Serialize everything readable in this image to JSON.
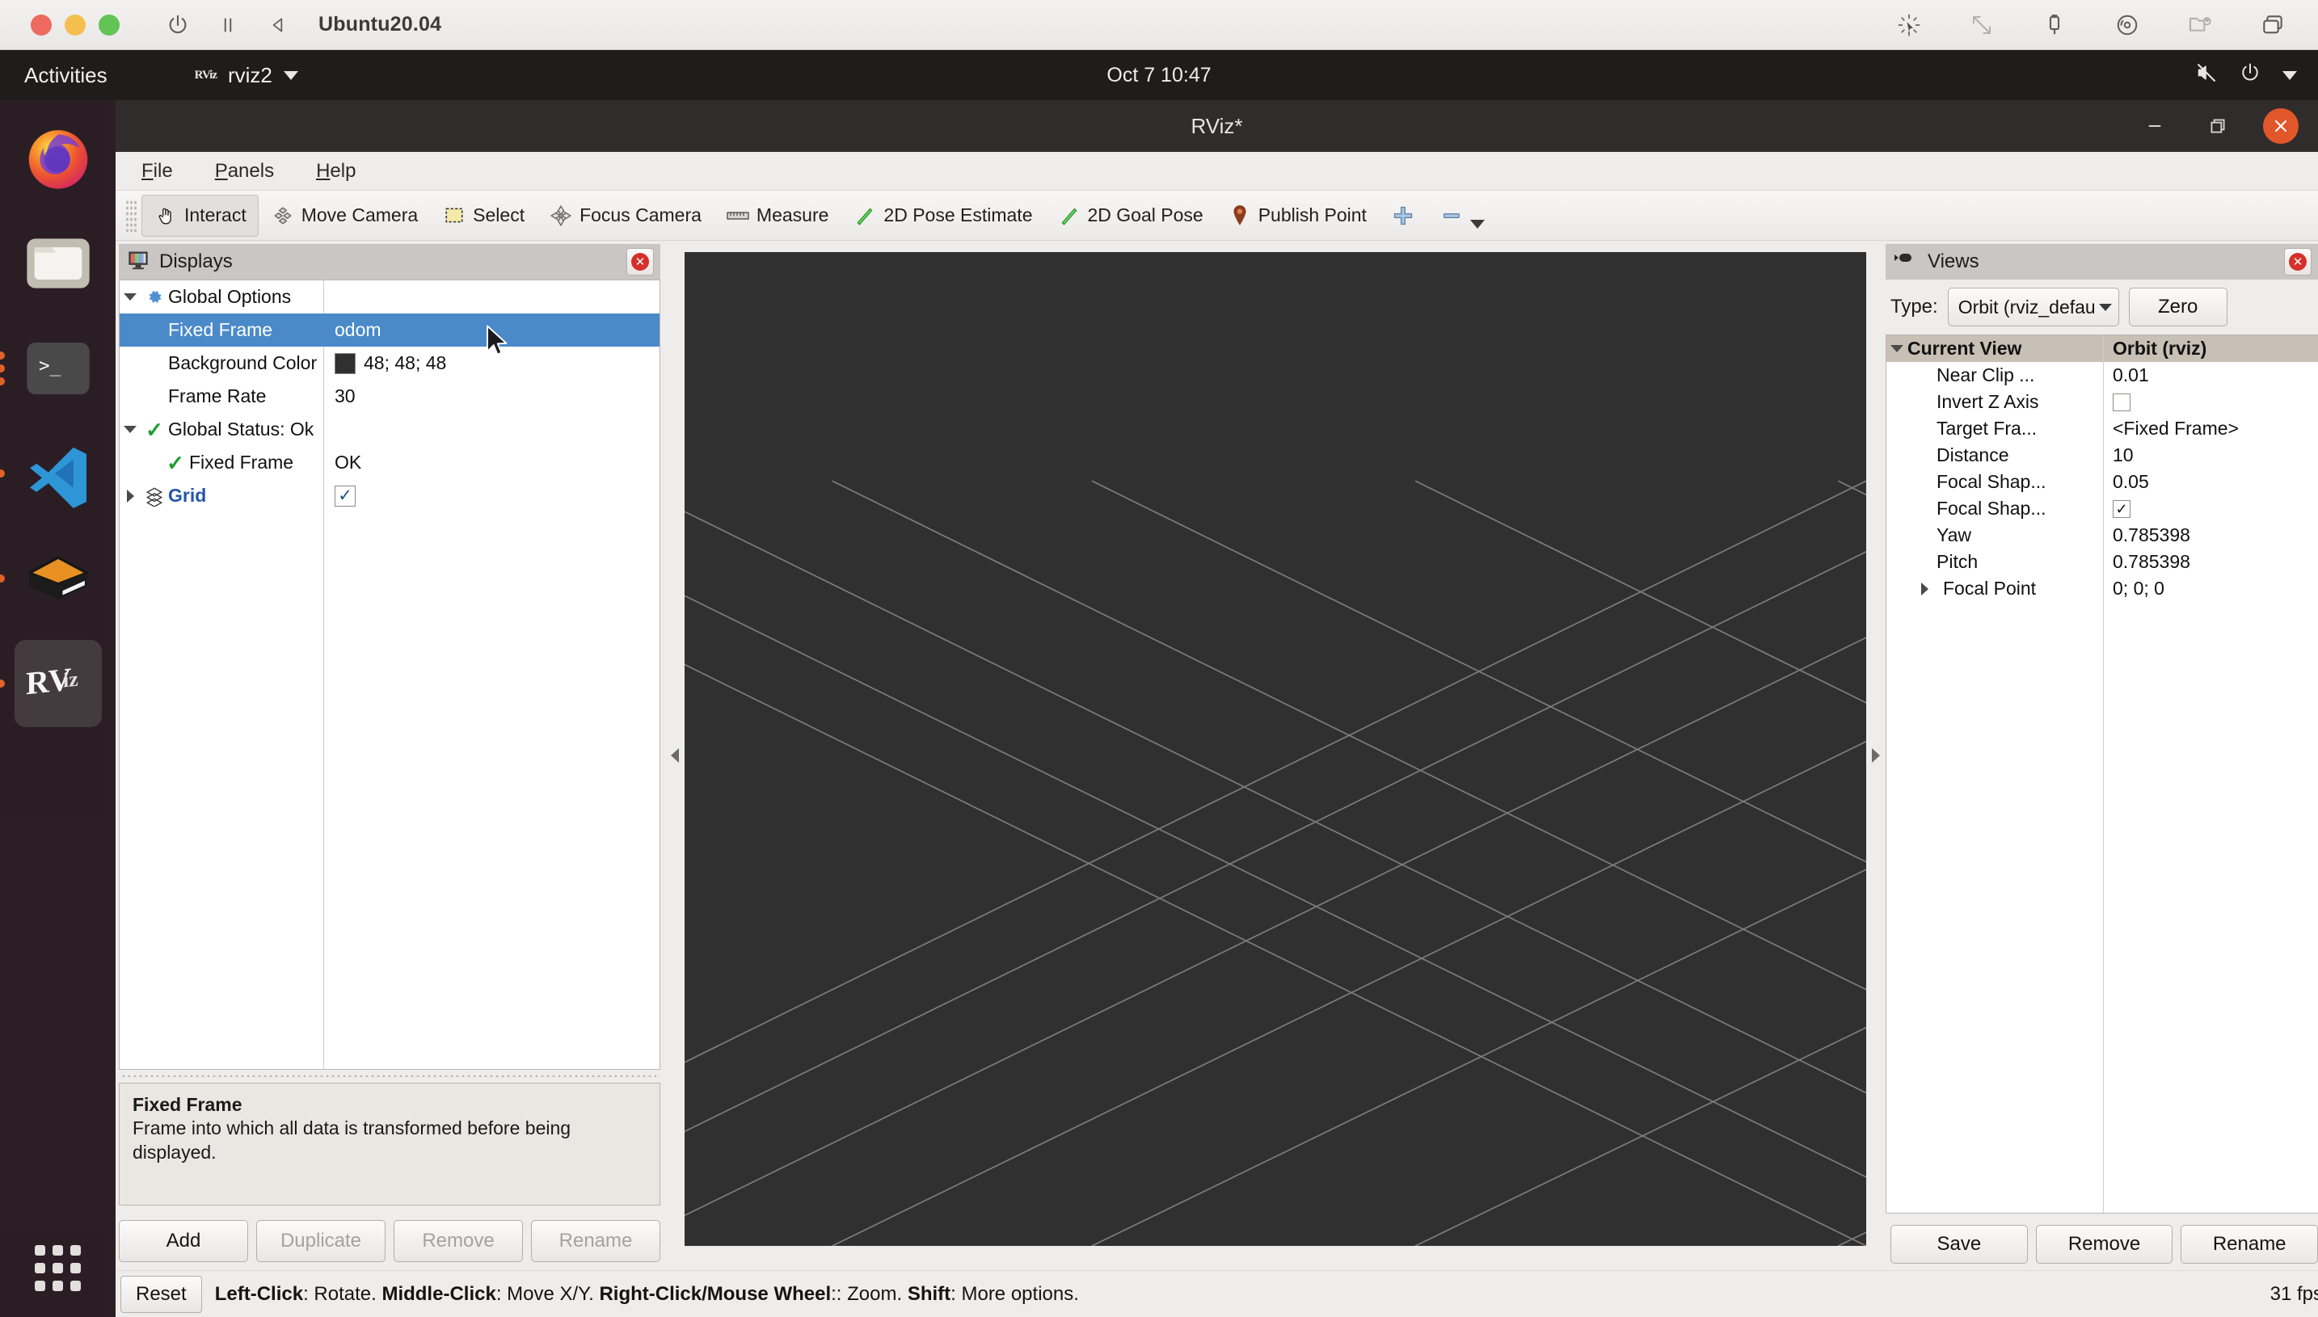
{
  "vm": {
    "title": "Ubuntu20.04",
    "traffic_lights": [
      "close",
      "minimize",
      "maximize"
    ],
    "left_icons": [
      "power-icon",
      "pause-icon",
      "back-icon"
    ],
    "right_icons": [
      "cursor-sparkle-icon",
      "resize-icon",
      "usb-icon",
      "disc-icon",
      "shared-folder-icon",
      "windows-icon"
    ]
  },
  "ubuntu_panel": {
    "activities": "Activities",
    "app_name": "rviz2",
    "app_badge": "RViz",
    "clock": "Oct 7  10:47",
    "status_icons": [
      "volume-muted-icon",
      "power-icon",
      "chevron-down-icon"
    ]
  },
  "dock": {
    "items": [
      {
        "name": "firefox",
        "label": "Firefox",
        "dots": 0,
        "active": false
      },
      {
        "name": "files",
        "label": "Files",
        "dots": 0,
        "active": false
      },
      {
        "name": "terminal",
        "label": "Terminal",
        "dots": 3,
        "active": false
      },
      {
        "name": "vscode",
        "label": "Visual Studio Code",
        "dots": 1,
        "active": false
      },
      {
        "name": "gazebo",
        "label": "Gazebo",
        "dots": 1,
        "active": false
      },
      {
        "name": "rviz",
        "label": "RViz",
        "dots": 1,
        "active": true
      }
    ],
    "show_apps": "Show Applications"
  },
  "window": {
    "title": "RViz*",
    "controls": [
      "minimize",
      "maximize",
      "close"
    ]
  },
  "menubar": {
    "items": [
      {
        "mnemonic": "F",
        "rest": "ile"
      },
      {
        "mnemonic": "P",
        "rest": "anels"
      },
      {
        "mnemonic": "H",
        "rest": "elp"
      }
    ]
  },
  "toolbar": {
    "buttons": [
      {
        "label": "Interact",
        "icon": "hand-pointer-icon",
        "checked": true
      },
      {
        "label": "Move Camera",
        "icon": "move-camera-icon",
        "checked": false
      },
      {
        "label": "Select",
        "icon": "select-rect-icon",
        "checked": false
      },
      {
        "label": "Focus Camera",
        "icon": "focus-camera-icon",
        "checked": false
      },
      {
        "label": "Measure",
        "icon": "ruler-icon",
        "checked": false
      },
      {
        "label": "2D Pose Estimate",
        "icon": "pose-arrow-icon",
        "checked": false
      },
      {
        "label": "2D Goal Pose",
        "icon": "pose-arrow-icon",
        "checked": false
      },
      {
        "label": "Publish Point",
        "icon": "map-pin-icon",
        "checked": false
      }
    ],
    "add_tool_icon": "plus-icon",
    "remove_tool_icon": "minus-icon"
  },
  "displays": {
    "panel_title": "Displays",
    "panel_icon": "monitor-icon",
    "close_icon": "close-icon",
    "rows": [
      {
        "name": "Global Options",
        "value": "",
        "indent": 0,
        "twisty": "down",
        "icon": "gear-icon",
        "bold_blue": false,
        "selected": false,
        "value_type": "text"
      },
      {
        "name": "Fixed Frame",
        "value": "odom",
        "indent": 1,
        "twisty": "",
        "icon": "",
        "bold_blue": false,
        "selected": true,
        "value_type": "text"
      },
      {
        "name": "Background Color",
        "value": "48; 48; 48",
        "indent": 1,
        "twisty": "",
        "icon": "",
        "bold_blue": false,
        "selected": false,
        "value_type": "color",
        "color": "#303030"
      },
      {
        "name": "Frame Rate",
        "value": "30",
        "indent": 1,
        "twisty": "",
        "icon": "",
        "bold_blue": false,
        "selected": false,
        "value_type": "text"
      },
      {
        "name": "Global Status: Ok",
        "value": "",
        "indent": 0,
        "twisty": "down",
        "icon": "check-icon",
        "bold_blue": false,
        "selected": false,
        "value_type": "text"
      },
      {
        "name": "Fixed Frame",
        "value": "OK",
        "indent": 1,
        "twisty": "",
        "icon": "check-icon",
        "bold_blue": false,
        "selected": false,
        "value_type": "text"
      },
      {
        "name": "Grid",
        "value": "",
        "indent": 0,
        "twisty": "right",
        "icon": "grid-icon",
        "bold_blue": true,
        "selected": false,
        "value_type": "checkbox",
        "checked": true
      }
    ],
    "help": {
      "title": "Fixed Frame",
      "body": "Frame into which all data is transformed before being displayed."
    },
    "buttons": [
      {
        "label": "Add",
        "enabled": true
      },
      {
        "label": "Duplicate",
        "enabled": false
      },
      {
        "label": "Remove",
        "enabled": false
      },
      {
        "label": "Rename",
        "enabled": false
      }
    ]
  },
  "views": {
    "panel_title": "Views",
    "panel_icon": "camera-icon",
    "close_icon": "close-icon",
    "type_label": "Type:",
    "type_value": "Orbit (rviz_defau",
    "zero_button": "Zero",
    "header": {
      "name": "Current View",
      "value": "Orbit (rviz)"
    },
    "rows": [
      {
        "name": "Near Clip ...",
        "value": "0.01",
        "type": "text"
      },
      {
        "name": "Invert Z Axis",
        "value": "",
        "type": "checkbox",
        "checked": false
      },
      {
        "name": "Target Fra...",
        "value": "<Fixed Frame>",
        "type": "text"
      },
      {
        "name": "Distance",
        "value": "10",
        "type": "text"
      },
      {
        "name": "Focal Shap...",
        "value": "0.05",
        "type": "text"
      },
      {
        "name": "Focal Shap...",
        "value": "",
        "type": "checkbox",
        "checked": true
      },
      {
        "name": "Yaw",
        "value": "0.785398",
        "type": "text"
      },
      {
        "name": "Pitch",
        "value": "0.785398",
        "type": "text"
      },
      {
        "name": "Focal Point",
        "value": "0; 0; 0",
        "type": "text",
        "twisty": "right"
      }
    ],
    "buttons": [
      {
        "label": "Save"
      },
      {
        "label": "Remove"
      },
      {
        "label": "Rename"
      }
    ]
  },
  "statusbar": {
    "reset_label": "Reset",
    "hint_parts": [
      {
        "text": "Left-Click",
        "bold": true
      },
      {
        "text": ": Rotate. ",
        "bold": false
      },
      {
        "text": "Middle-Click",
        "bold": true
      },
      {
        "text": ": Move X/Y. ",
        "bold": false
      },
      {
        "text": "Right-Click/Mouse Wheel",
        "bold": true
      },
      {
        "text": ":: Zoom. ",
        "bold": false
      },
      {
        "text": "Shift",
        "bold": true
      },
      {
        "text": ": More options.",
        "bold": false
      }
    ],
    "fps": "31 fps"
  },
  "viewport": {
    "background_color": "#303030",
    "grid_line_color": "#9a9a9a",
    "grid_cells": 10
  },
  "colors": {
    "selection_blue": "#4a8ac9",
    "accent_orange": "#e1572a",
    "ok_green": "#1f9b2e",
    "link_blue": "#2456a8"
  }
}
